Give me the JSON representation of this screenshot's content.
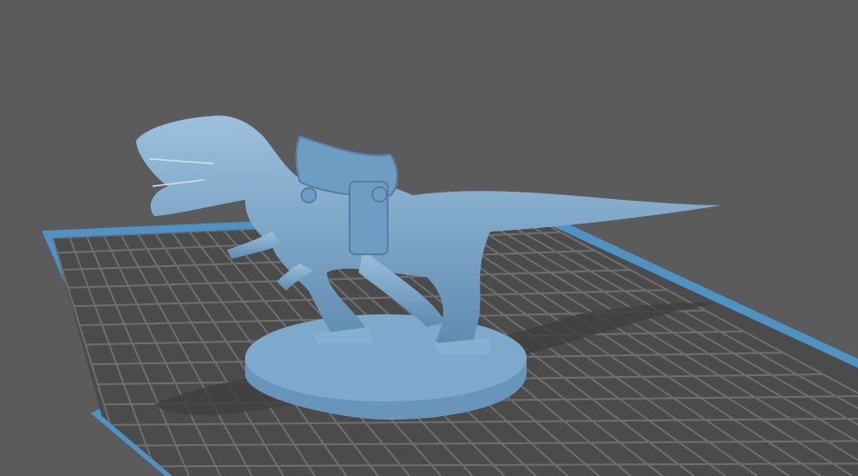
{
  "viewport": {
    "background_color": "#5b5b5b",
    "plate_color": "#4b4b4b",
    "grid_color": "#707070",
    "plate_border_color": "#4e93c4",
    "model_color": "#7ea9cc",
    "model_shadow_color": "#5f8bb0"
  }
}
